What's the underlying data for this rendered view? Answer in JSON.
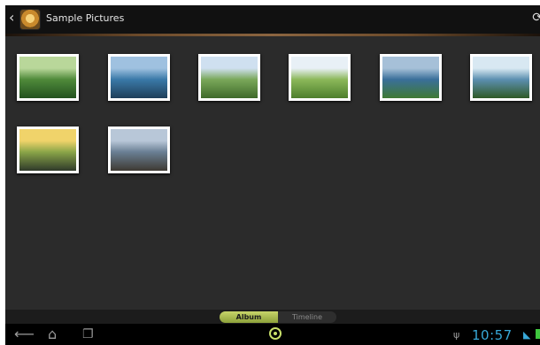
{
  "actionbar": {
    "title": "Sample Pictures",
    "back_icon": "chevron-left-icon",
    "refresh_icon": "refresh-icon",
    "app_icon": "gallery-app-icon"
  },
  "photos": [
    {
      "name": "forest-boardwalk",
      "colors": [
        "#b9d79a",
        "#4f8a3a",
        "#23521f"
      ]
    },
    {
      "name": "mountain-lake",
      "colors": [
        "#9fc1e0",
        "#3a79a8",
        "#1f3f5a"
      ]
    },
    {
      "name": "river-meadow",
      "colors": [
        "#cfe0f0",
        "#7aa85a",
        "#3f6a2a"
      ]
    },
    {
      "name": "green-valley",
      "colors": [
        "#e8f0f6",
        "#8cb85a",
        "#4d7f2c"
      ]
    },
    {
      "name": "coastal-cliffs",
      "colors": [
        "#a6c0d8",
        "#3a6f9a",
        "#3f7a34"
      ]
    },
    {
      "name": "sea-cliffs",
      "colors": [
        "#d8e8f2",
        "#5c8fb0",
        "#2f5a26"
      ]
    },
    {
      "name": "autumn-road",
      "colors": [
        "#f0d36a",
        "#8aa548",
        "#2f3a2a"
      ]
    },
    {
      "name": "rocky-shore",
      "colors": [
        "#b8c7d8",
        "#6a7f94",
        "#3e3a33"
      ]
    }
  ],
  "tabs": {
    "album": "Album",
    "timeline": "Timeline"
  },
  "statusbar": {
    "time": "10:57"
  },
  "nav_icons": {
    "back": "back-arrow-icon",
    "home": "home-icon",
    "recents": "recent-apps-icon"
  }
}
